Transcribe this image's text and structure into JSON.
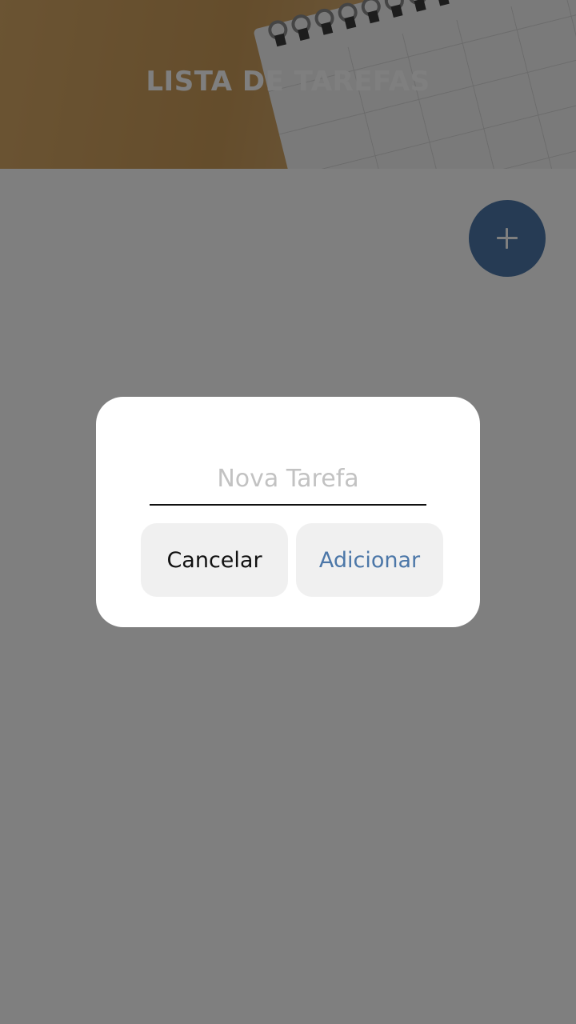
{
  "header": {
    "title": "LISTA DE TAREFAS",
    "background_image": "desk-calendar-photo"
  },
  "fab": {
    "icon": "plus-icon",
    "color": "#4c77a8"
  },
  "dialog": {
    "input_placeholder": "Nova Tarefa",
    "input_value": "",
    "cancel_label": "Cancelar",
    "add_label": "Adicionar",
    "accent_color": "#4c77a8"
  }
}
